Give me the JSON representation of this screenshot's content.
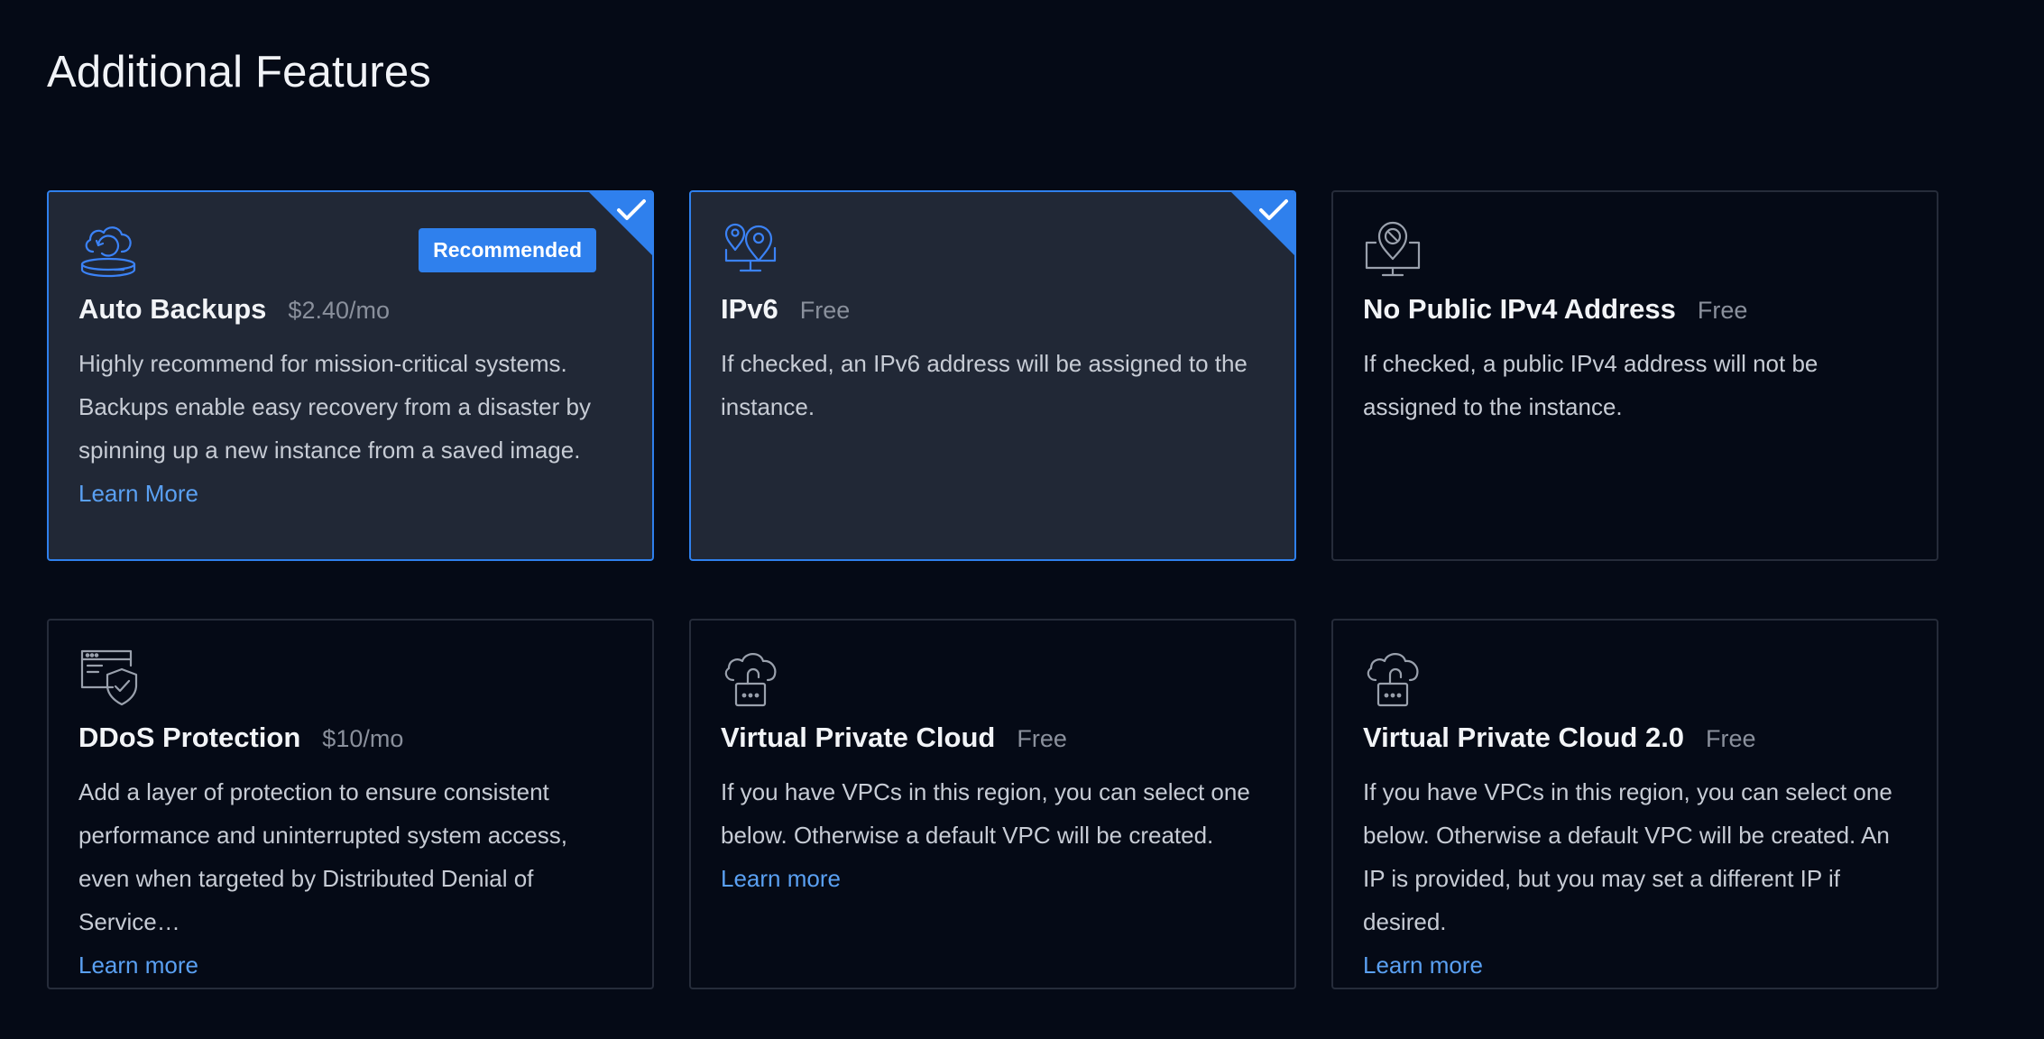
{
  "section": {
    "title": "Additional Features"
  },
  "colors": {
    "accent": "#2f80ed",
    "background": "#050a16",
    "selected_card_bg": "#212836",
    "link": "#5aa0f2"
  },
  "cards": [
    {
      "id": "auto-backups",
      "icon": "cloud-backup-icon",
      "title": "Auto Backups",
      "price": "$2.40/mo",
      "description": "Highly recommend for mission-critical systems. Backups enable easy recovery from a disaster by spinning up a new instance from a saved image.",
      "link": "Learn More",
      "badge": "Recommended",
      "selected": true
    },
    {
      "id": "ipv6",
      "icon": "network-pins-icon",
      "title": "IPv6",
      "price": "Free",
      "description": "If checked, an IPv6 address will be assigned to the instance.",
      "link": "",
      "selected": true
    },
    {
      "id": "no-public-ipv4",
      "icon": "no-network-pin-icon",
      "title": "No Public IPv4 Address",
      "price": "Free",
      "description": "If checked, a public IPv4 address will not be assigned to the instance.",
      "link": "",
      "selected": false
    },
    {
      "id": "ddos-protection",
      "icon": "browser-shield-icon",
      "title": "DDoS Protection",
      "price": "$10/mo",
      "description": "Add a layer of protection to ensure consistent performance and uninterrupted system access, even when targeted by Distributed Denial of Service…",
      "link": "Learn more",
      "selected": false
    },
    {
      "id": "vpc",
      "icon": "cloud-lock-icon",
      "title": "Virtual Private Cloud",
      "price": "Free",
      "description": "If you have VPCs in this region, you can select one below. Otherwise a default VPC will be created.",
      "link": "Learn more",
      "selected": false
    },
    {
      "id": "vpc-2",
      "icon": "cloud-lock-icon",
      "title": "Virtual Private Cloud 2.0",
      "price": "Free",
      "description": "If you have VPCs in this region, you can select one below. Otherwise a default VPC will be created. An IP is provided, but you may set a different IP if desired.",
      "link": "Learn more",
      "selected": false
    }
  ]
}
